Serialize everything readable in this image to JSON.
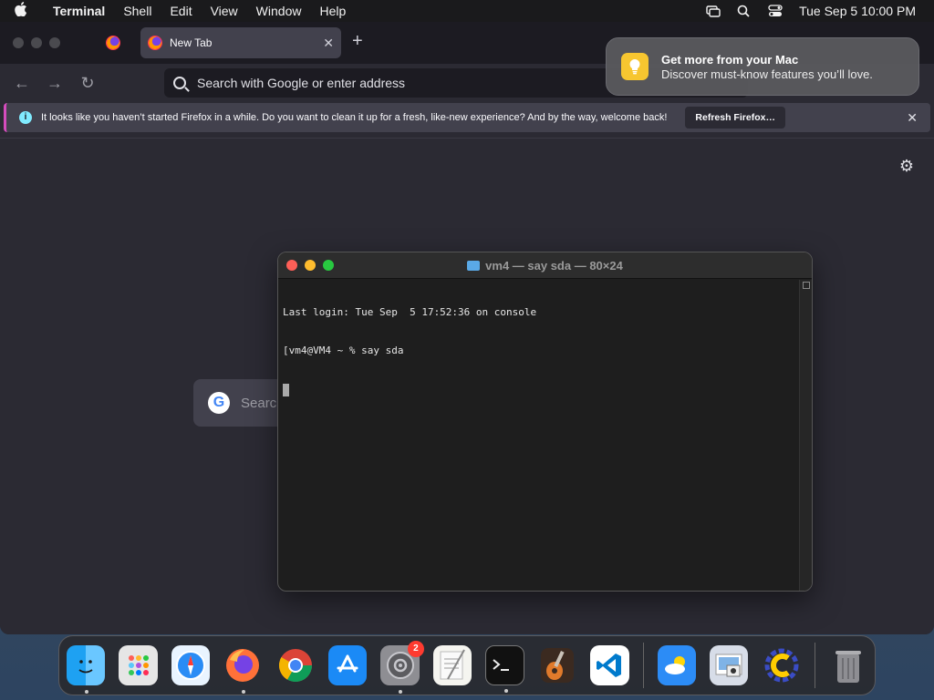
{
  "menubar": {
    "app_name": "Terminal",
    "items": [
      "Shell",
      "Edit",
      "View",
      "Window",
      "Help"
    ],
    "datetime": "Tue Sep 5  10:00 PM"
  },
  "firefox": {
    "active_tab_title": "New Tab",
    "url_placeholder": "Search with Google or enter address",
    "notification": {
      "message": "It looks like you haven’t started Firefox in a while. Do you want to clean it up for a fresh, like-new experience? And by the way, welcome back!",
      "button_label": "Refresh Firefox…"
    },
    "content_search_placeholder": "Search"
  },
  "mac_notification": {
    "title": "Get more from your Mac",
    "body": "Discover must-know features you’ll love."
  },
  "terminal": {
    "title": "vm4 — say sda — 80×24",
    "lines": [
      "Last login: Tue Sep  5 17:52:36 on console",
      "[vm4@VM4 ~ % say sda"
    ]
  },
  "dock": {
    "apps": [
      {
        "name": "Finder",
        "running": true
      },
      {
        "name": "Launchpad",
        "running": false
      },
      {
        "name": "Safari",
        "running": false
      },
      {
        "name": "Firefox",
        "running": true
      },
      {
        "name": "Chrome",
        "running": false
      },
      {
        "name": "App Store",
        "running": false
      },
      {
        "name": "System Preferences",
        "running": true,
        "badge": "2"
      },
      {
        "name": "TextEdit",
        "running": false
      },
      {
        "name": "Terminal",
        "running": true
      },
      {
        "name": "GarageBand",
        "running": false
      },
      {
        "name": "VS Code",
        "running": false
      },
      {
        "name": "Weather",
        "running": false
      },
      {
        "name": "Preview",
        "running": false
      },
      {
        "name": "Cuckoo",
        "running": false
      },
      {
        "name": "Trash",
        "running": false
      }
    ]
  }
}
